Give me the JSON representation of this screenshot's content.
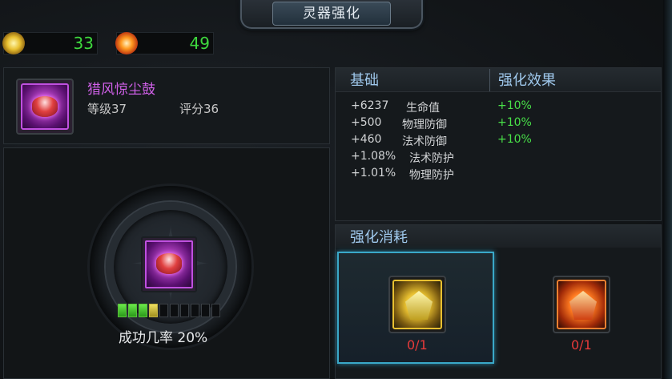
{
  "header": {
    "title": "灵器强化"
  },
  "currency": [
    {
      "icon": "gold-orb-icon",
      "value": "33"
    },
    {
      "icon": "fire-orb-icon",
      "value": "49"
    }
  ],
  "item": {
    "name": "猎风惊尘鼓",
    "level": "等级37",
    "score": "评分36",
    "icon": "war-drum-icon"
  },
  "enhance": {
    "progress_filled": 3,
    "progress_current": 1,
    "progress_total": 10,
    "success_rate": "成功几率 20%"
  },
  "stats": {
    "header_base": "基础",
    "header_effect": "强化效果",
    "rows": [
      {
        "value": "+6237",
        "name": "生命值",
        "effect": "+10%"
      },
      {
        "value": "+500",
        "name": "物理防御",
        "effect": "+10%"
      },
      {
        "value": "+460",
        "name": "法术防御",
        "effect": "+10%"
      },
      {
        "value": "+1.08%",
        "name": "法术防护",
        "effect": ""
      },
      {
        "value": "+1.01%",
        "name": "物理防护",
        "effect": ""
      }
    ]
  },
  "cost": {
    "header": "强化消耗",
    "materials": [
      {
        "icon": "gold-stone-icon",
        "count": "0/1"
      },
      {
        "icon": "fire-stone-icon",
        "count": "0/1"
      }
    ]
  },
  "colors": {
    "accent_green": "#3ed93e",
    "item_purple": "#d060e8",
    "header_blue": "#9fc8ec",
    "insufficient_red": "#e83a3a",
    "selected_border": "#3aa8c8"
  }
}
